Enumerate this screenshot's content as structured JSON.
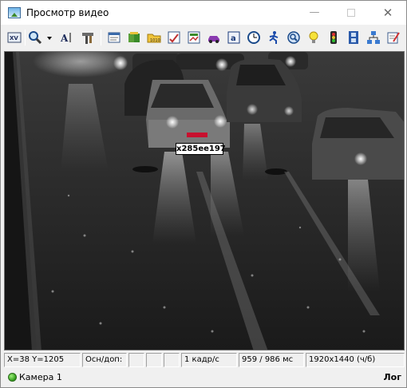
{
  "window": {
    "title": "Просмотр видео",
    "controls": {
      "minimize": "—",
      "close": "✕"
    }
  },
  "toolbar": {
    "tools": [
      {
        "name": "video-mode-icon",
        "glyph": "XV"
      },
      {
        "name": "zoom-icon",
        "glyph": "🔍"
      },
      {
        "name": "text-recognition-icon",
        "glyph": "A|"
      },
      {
        "name": "tools-icon",
        "glyph": "⚒"
      },
      {
        "name": "settings-icon",
        "glyph": "▤"
      },
      {
        "name": "book-icon",
        "glyph": "▥"
      },
      {
        "name": "folder-icon",
        "glyph": "▧"
      },
      {
        "name": "chart-icon",
        "glyph": "☑"
      },
      {
        "name": "report-icon",
        "glyph": "▨"
      },
      {
        "name": "car-icon",
        "glyph": "🚗"
      },
      {
        "name": "card-icon",
        "glyph": "▦"
      },
      {
        "name": "clock-icon",
        "glyph": "◷"
      },
      {
        "name": "walker-icon",
        "glyph": "🏃"
      },
      {
        "name": "search-globe-icon",
        "glyph": "◉"
      },
      {
        "name": "bulb-icon",
        "glyph": "💡"
      },
      {
        "name": "traffic-light-icon",
        "glyph": "🚦"
      },
      {
        "name": "film-icon",
        "glyph": "▮"
      },
      {
        "name": "network-icon",
        "glyph": "⚏"
      },
      {
        "name": "edit-icon",
        "glyph": "✎"
      }
    ]
  },
  "video": {
    "plate_text": "х285ее197"
  },
  "status": {
    "coords": "X=38 Y=1205",
    "osn_dop": "Осн/доп:",
    "empty1": "",
    "empty2": "",
    "fps": "1 кадр/с",
    "frames": "959 / 986 мс",
    "resolution": "1920x1440 (ч/б)"
  },
  "bottom": {
    "camera": "Камера 1",
    "log": "Лог"
  },
  "colors": {
    "camera_status": "#2f9a1a",
    "plate_red": "#c8102e"
  }
}
